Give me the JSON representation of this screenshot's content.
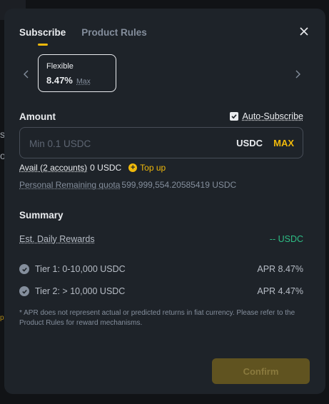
{
  "background": {
    "side_glyph_1": "s",
    "side_glyph_2": "o",
    "side_glyph_3": "p"
  },
  "tabs": [
    {
      "label": "Subscribe",
      "active": true
    },
    {
      "label": "Product Rules",
      "active": false
    }
  ],
  "term": {
    "name": "Flexible",
    "rate": "8.47%",
    "max_label": "Max"
  },
  "amount": {
    "label": "Amount",
    "auto_subscribe_label": "Auto-Subscribe",
    "auto_subscribe_checked": true,
    "placeholder": "Min 0.1 USDC",
    "value": "",
    "unit": "USDC",
    "max_label": "MAX"
  },
  "avail": {
    "label": "Avail (2 accounts)",
    "value": "0 USDC",
    "topup_label": "Top up"
  },
  "quota": {
    "label": "Personal Remaining quota",
    "value": "599,999,554.20585419 USDC"
  },
  "summary": {
    "title": "Summary",
    "est_label": "Est. Daily Rewards",
    "est_value": "-- USDC",
    "tiers": [
      {
        "label": "Tier 1: 0-10,000 USDC",
        "apr": "APR 8.47%"
      },
      {
        "label": "Tier 2: > 10,000 USDC",
        "apr": "APR 4.47%"
      }
    ]
  },
  "disclaimer": "* APR does not represent actual or predicted returns in fiat currency. Please refer to the Product Rules for reward mechanisms.",
  "confirm_label": "Confirm",
  "colors": {
    "accent": "#f0b90b",
    "positive": "#2ebd85",
    "modal_bg": "#1e2329",
    "page_bg": "#111316"
  }
}
